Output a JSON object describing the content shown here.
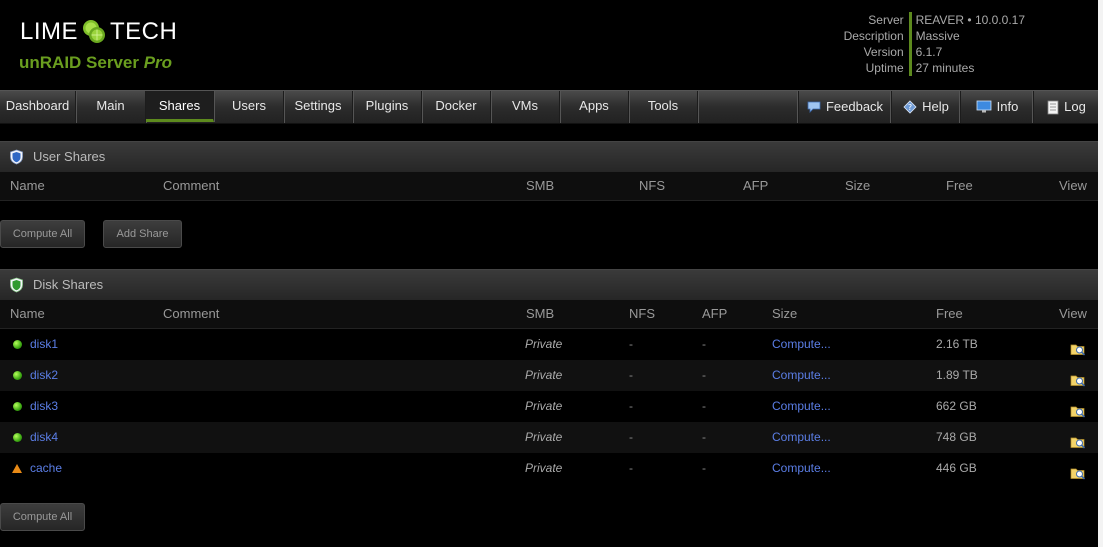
{
  "header": {
    "logo_left": "LIME",
    "logo_right": "TECH",
    "product": "unRAID Server",
    "product_tier": "Pro",
    "server_info": [
      {
        "key": "Server",
        "value": "REAVER • 10.0.0.17"
      },
      {
        "key": "Description",
        "value": "Massive"
      },
      {
        "key": "Version",
        "value": "6.1.7"
      },
      {
        "key": "Uptime",
        "value": "27 minutes"
      }
    ]
  },
  "nav": {
    "tabs": [
      "Dashboard",
      "Main",
      "Shares",
      "Users",
      "Settings",
      "Plugins",
      "Docker",
      "VMs",
      "Apps",
      "Tools"
    ],
    "active": "Shares",
    "right": [
      {
        "label": "Feedback",
        "icon": "speech-bubble-icon"
      },
      {
        "label": "Help",
        "icon": "help-diamond-icon"
      },
      {
        "label": "Info",
        "icon": "monitor-icon"
      },
      {
        "label": "Log",
        "icon": "document-icon"
      }
    ]
  },
  "user_shares": {
    "title": "User Shares",
    "columns": [
      "Name",
      "Comment",
      "SMB",
      "NFS",
      "AFP",
      "Size",
      "Free",
      "View"
    ],
    "buttons": [
      "Compute All",
      "Add Share"
    ]
  },
  "disk_shares": {
    "title": "Disk Shares",
    "columns": [
      "Name",
      "Comment",
      "SMB",
      "NFS",
      "AFP",
      "Size",
      "Free",
      "View"
    ],
    "rows": [
      {
        "name": "disk1",
        "status": "green",
        "smb": "Private",
        "nfs": "-",
        "afp": "-",
        "size": "Compute...",
        "free": "2.16 TB"
      },
      {
        "name": "disk2",
        "status": "green",
        "smb": "Private",
        "nfs": "-",
        "afp": "-",
        "size": "Compute...",
        "free": "1.89 TB"
      },
      {
        "name": "disk3",
        "status": "green",
        "smb": "Private",
        "nfs": "-",
        "afp": "-",
        "size": "Compute...",
        "free": "662 GB"
      },
      {
        "name": "disk4",
        "status": "green",
        "smb": "Private",
        "nfs": "-",
        "afp": "-",
        "size": "Compute...",
        "free": "748 GB"
      },
      {
        "name": "cache",
        "status": "warning",
        "smb": "Private",
        "nfs": "-",
        "afp": "-",
        "size": "Compute...",
        "free": "446 GB"
      }
    ],
    "buttons": [
      "Compute All"
    ]
  },
  "colors": {
    "accent_green": "#5d8a1e",
    "link_blue": "#5b7ee6",
    "warning_orange": "#e88a16"
  }
}
